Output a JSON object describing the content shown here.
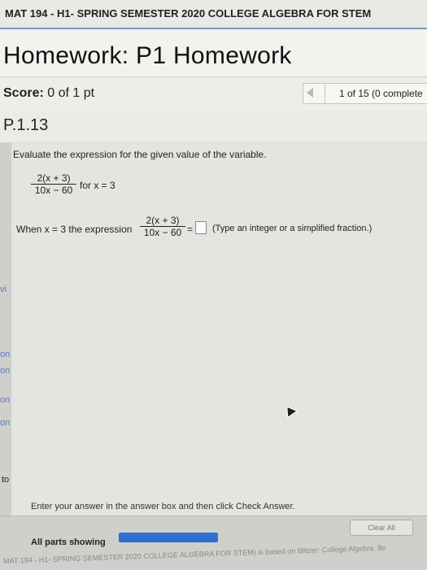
{
  "course": {
    "title": "MAT 194 - H1- SPRING SEMESTER 2020 COLLEGE ALGEBRA FOR STEM"
  },
  "homework": {
    "title": "Homework: P1 Homework"
  },
  "score": {
    "label": "Score:",
    "value": "0 of 1 pt"
  },
  "nav": {
    "status": "1 of 15 (0 complete"
  },
  "question": {
    "number": "P.1.13",
    "prompt": "Evaluate the expression for the given value of the variable.",
    "expression_numerator": "2(x + 3)",
    "expression_denominator": "10x − 60",
    "for_text": "for x = 3",
    "when_text": "When x = 3 the expression",
    "equals": "=",
    "answer_value": "",
    "hint": "(Type an integer or a simplified fraction.)"
  },
  "side_fragments": [
    "vi",
    "on",
    "on",
    "on",
    "on",
    "to"
  ],
  "instruction": "Enter your answer in the answer box and then click Check Answer.",
  "footer": {
    "all_parts": "All parts showing",
    "clear_all": "Clear All",
    "bottom_text": "MAT 194 - H1- SPRING SEMESTER 2020 COLLEGE ALGEBRA FOR STEM) is based on Blitzer: College Algebra, 8e"
  },
  "colors": {
    "accent": "#2f6fd2",
    "header_rule": "#7a9cc0"
  }
}
